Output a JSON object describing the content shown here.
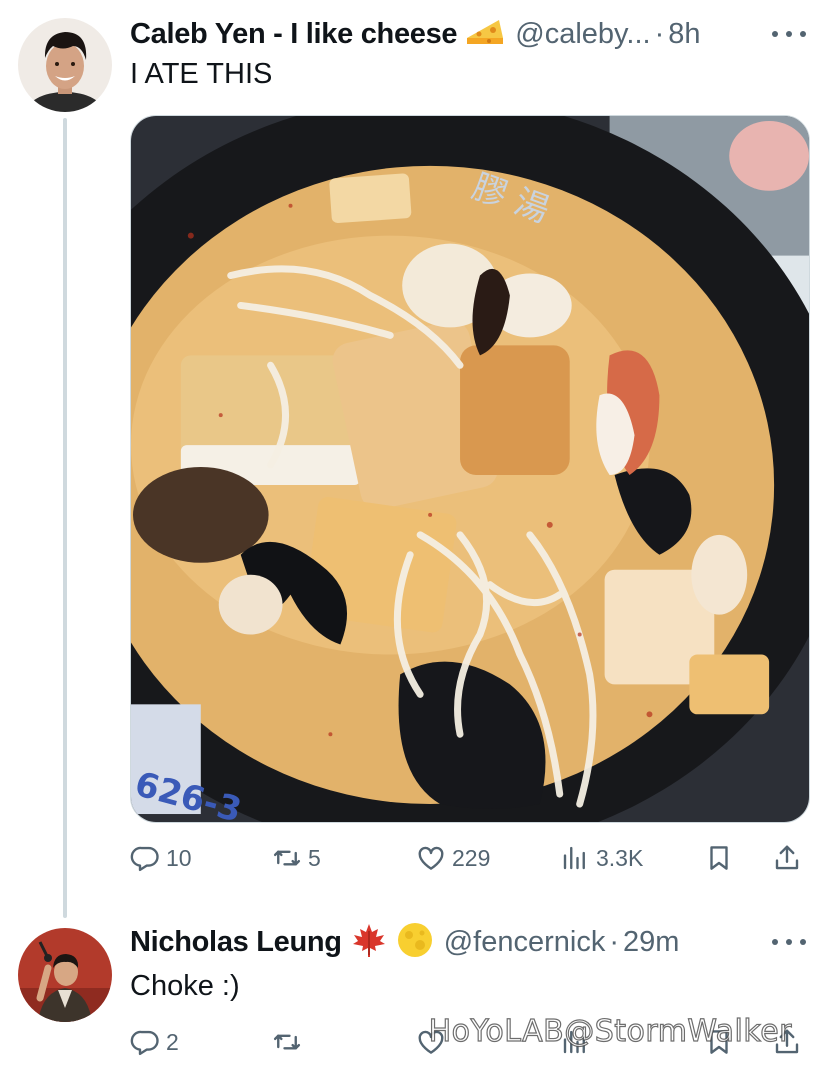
{
  "tweet1": {
    "name": "Caleb Yen - I like cheese",
    "name_emoji": "cheese-icon",
    "handle": "@caleby...",
    "separator": "·",
    "time": "8h",
    "text": "I ATE THIS",
    "media_alt": "bowl of laksa noodle soup with tofu, fish balls, crab sticks and wood ear mushrooms",
    "actions": {
      "replies": "10",
      "retweets": "5",
      "likes": "229",
      "views": "3.3K"
    }
  },
  "tweet2": {
    "name": "Nicholas Leung",
    "name_emojis": [
      "maple-leaf-icon",
      "full-moon-icon"
    ],
    "handle": "@fencernick",
    "separator": "·",
    "time": "29m",
    "text": "Choke :)",
    "actions": {
      "replies": "2"
    }
  },
  "watermark": "HoYoLAB@StormWalker",
  "colors": {
    "text_primary": "#0f1419",
    "text_secondary": "#536471",
    "thread_line": "#cfd9de",
    "background": "#ffffff"
  }
}
